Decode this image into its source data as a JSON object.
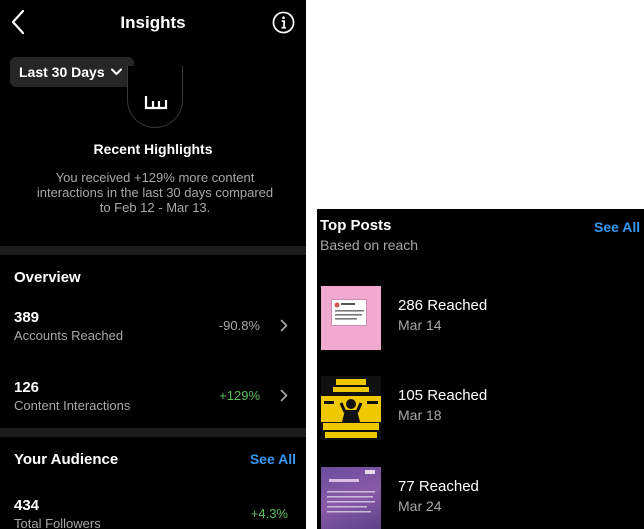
{
  "insights": {
    "title": "Insights",
    "range": "Last 30 Days",
    "highlights": {
      "title": "Recent Highlights",
      "text": "You received +129% more content interactions in the last 30 days compared to Feb 12 - Mar 13."
    },
    "overview": {
      "title": "Overview",
      "metrics": [
        {
          "value": "389",
          "label": "Accounts Reached",
          "change": "-90.8%"
        },
        {
          "value": "126",
          "label": "Content Interactions",
          "change": "+129%"
        }
      ]
    },
    "audience": {
      "title": "Your Audience",
      "see_all": "See All",
      "metrics": [
        {
          "value": "434",
          "label": "Total Followers",
          "change": "+4.3%"
        }
      ]
    }
  },
  "top_posts": {
    "title": "Top Posts",
    "subtitle": "Based on reach",
    "see_all": "See All",
    "posts": [
      {
        "reach": "286 Reached",
        "date": "Mar 14"
      },
      {
        "reach": "105 Reached",
        "date": "Mar 18"
      },
      {
        "reach": "77 Reached",
        "date": "Mar 24"
      }
    ]
  },
  "colors": {
    "background": "#000000",
    "secondary_text": "#a8a8a8",
    "link_blue": "#3897f0",
    "positive_green": "#5bbf5b",
    "separator": "#1c1c1c"
  },
  "icons": [
    "back-chevron-icon",
    "info-icon",
    "chevron-down-icon",
    "bar-chart-icon",
    "chevron-right-icon"
  ]
}
